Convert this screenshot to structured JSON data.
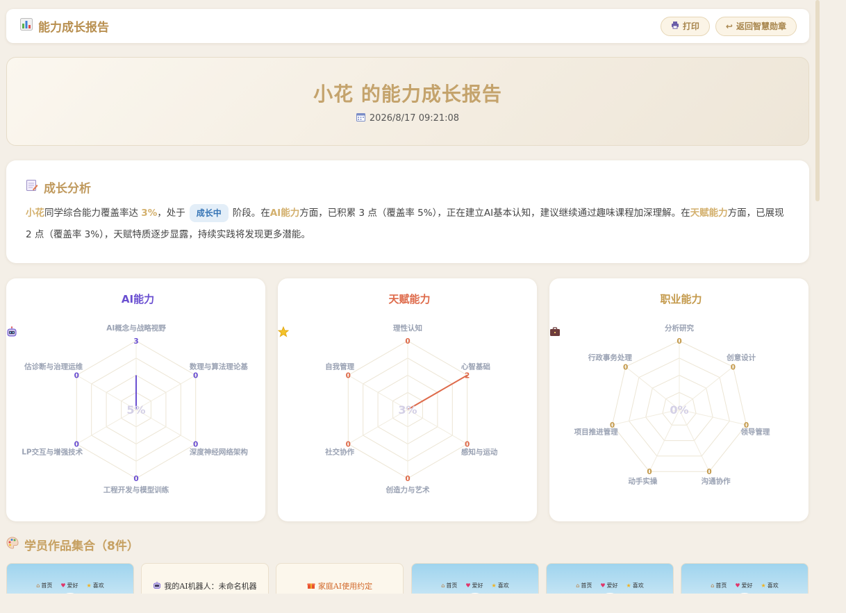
{
  "header": {
    "title": "能力成长报告",
    "print_label": "打印",
    "back_label": "返回智慧勋章"
  },
  "hero": {
    "title": "小花 的能力成长报告",
    "date": "2026/8/17 09:21:08"
  },
  "analysis": {
    "heading": "成长分析",
    "student": "小花",
    "t1": "同学综合能力覆盖率达 ",
    "rate": "3%",
    "t2": "，处于",
    "stage": "成长中",
    "t3": "阶段。在",
    "ai_label": "AI能力",
    "t4": "方面，已积累 3 点（覆盖率 5%），正在建立AI基本认知，建议继续通过趣味课程加深理解。在",
    "talent_label": "天赋能力",
    "t5": "方面，已展现 2 点（覆盖率 3%），天赋特质逐步显露，持续实践将发现更多潜能。"
  },
  "radars": [
    {
      "title": "AI能力",
      "icon": "robot-icon",
      "color": "#6a4fd1",
      "center": "5%",
      "labels": [
        "AI概念与战略视野",
        "数理与算法理论基",
        "深度神经网络架构",
        "工程开发与模型训练",
        "LP交互与增强技术",
        "估诊断与治理运维"
      ],
      "values": [
        3,
        0,
        0,
        0,
        0,
        0
      ],
      "max": 6
    },
    {
      "title": "天赋能力",
      "icon": "star-icon",
      "color": "#de6a4a",
      "center": "3%",
      "labels": [
        "理性认知",
        "心智基础",
        "感知与运动",
        "创造力与艺术",
        "社交协作",
        "自我管理"
      ],
      "values": [
        0,
        2,
        0,
        0,
        0,
        0
      ],
      "max": 2
    },
    {
      "title": "职业能力",
      "icon": "briefcase-icon",
      "color": "#c49a4c",
      "center": "0%",
      "labels": [
        "分析研究",
        "创意设计",
        "领导管理",
        "沟通协作",
        "动手实操",
        "项目推进管理",
        "行政事务处理"
      ],
      "values": [
        0,
        0,
        0,
        0,
        0,
        0,
        0
      ],
      "max": 6
    }
  ],
  "works": {
    "title": "学员作品集合（8件）",
    "nav": [
      "首页",
      "爱好",
      "喜欢"
    ],
    "card2": "我的AI机器人：未命名机器",
    "card3": "家庭AI使用约定"
  }
}
